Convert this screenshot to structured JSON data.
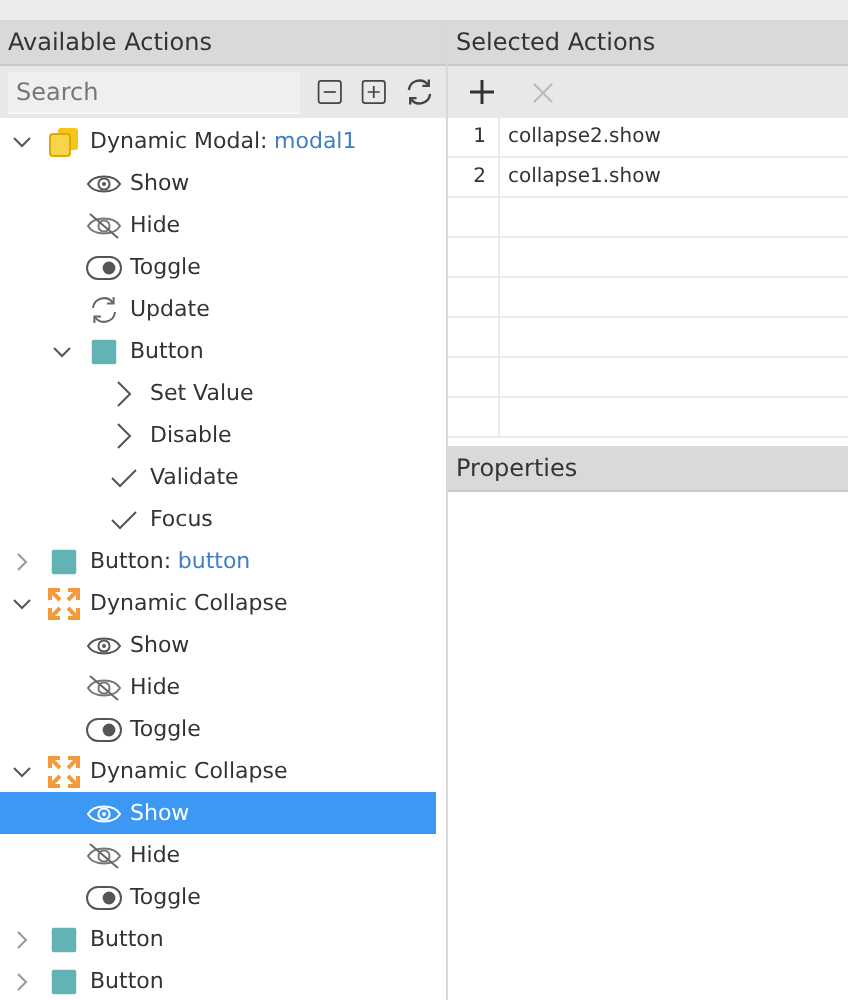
{
  "available_actions": {
    "title": "Available Actions",
    "search": {
      "placeholder": "Search"
    },
    "tree": [
      {
        "kind": "modal",
        "label": "Dynamic Modal:",
        "name": "modal1",
        "expanded": true,
        "selected": false,
        "children": [
          {
            "kind": "eye",
            "label": "Show",
            "selected": false
          },
          {
            "kind": "eye-off",
            "label": "Hide",
            "selected": false
          },
          {
            "kind": "toggle",
            "label": "Toggle",
            "selected": false
          },
          {
            "kind": "refresh",
            "label": "Update",
            "selected": false
          },
          {
            "kind": "square",
            "label": "Button",
            "expanded": true,
            "selected": false,
            "children": [
              {
                "kind": "chevron",
                "label": "Set Value",
                "selected": false
              },
              {
                "kind": "chevron",
                "label": "Disable",
                "selected": false
              },
              {
                "kind": "check",
                "label": "Validate",
                "selected": false
              },
              {
                "kind": "check",
                "label": "Focus",
                "selected": false
              }
            ]
          }
        ]
      },
      {
        "kind": "square",
        "label": "Button:",
        "name": "button",
        "expanded": false,
        "selected": false
      },
      {
        "kind": "collapse",
        "label": "Dynamic Collapse",
        "expanded": true,
        "selected": false,
        "children": [
          {
            "kind": "eye",
            "label": "Show",
            "selected": false
          },
          {
            "kind": "eye-off",
            "label": "Hide",
            "selected": false
          },
          {
            "kind": "toggle",
            "label": "Toggle",
            "selected": false
          }
        ]
      },
      {
        "kind": "collapse",
        "label": "Dynamic Collapse",
        "expanded": true,
        "selected": false,
        "children": [
          {
            "kind": "eye",
            "label": "Show",
            "selected": true
          },
          {
            "kind": "eye-off",
            "label": "Hide",
            "selected": false
          },
          {
            "kind": "toggle",
            "label": "Toggle",
            "selected": false
          }
        ]
      },
      {
        "kind": "square",
        "label": "Button",
        "expanded": false,
        "selected": false
      },
      {
        "kind": "square",
        "label": "Button",
        "expanded": false,
        "selected": false
      }
    ]
  },
  "selected_actions": {
    "title": "Selected Actions",
    "rows": [
      {
        "index": "1",
        "action": "collapse2.show"
      },
      {
        "index": "2",
        "action": "collapse1.show"
      }
    ]
  },
  "properties": {
    "title": "Properties"
  }
}
